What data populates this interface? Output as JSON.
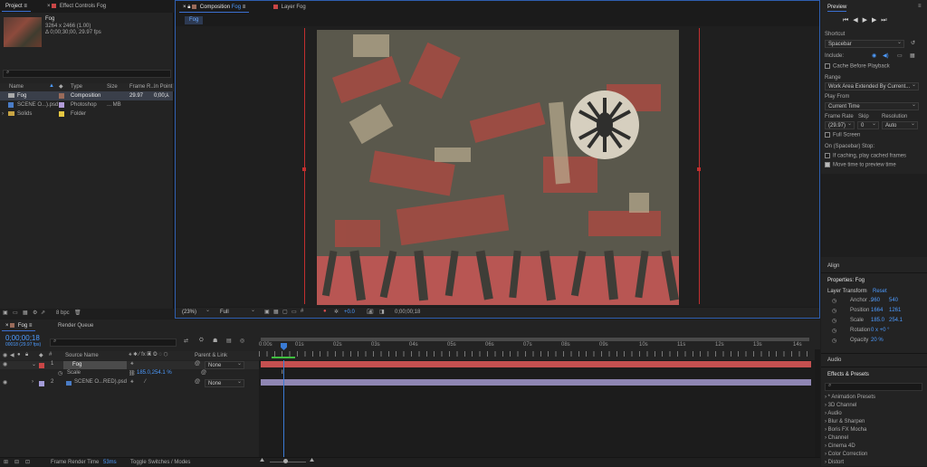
{
  "project": {
    "tab_project": "Project",
    "tab_effect_controls": "Effect Controls",
    "tab_effect_controls_target": "Fog",
    "thumb": {
      "name": "Fog",
      "dims": "3264 x 2466 (1.00)",
      "duration": "Δ 0;00;30;00, 29.97 fps"
    },
    "columns": [
      "Name",
      "Type",
      "Size",
      "Frame R...",
      "In Point"
    ],
    "items": [
      {
        "name": "Fog",
        "type": "Composition",
        "size": "",
        "fps": "29.97",
        "in": "0;00;",
        "color": "#9a6b5a"
      },
      {
        "name": "SCENE O...).psd",
        "type": "Photoshop",
        "size": "... MB",
        "fps": "",
        "in": "",
        "color": "#b29bd8"
      },
      {
        "name": "Solids",
        "type": "Folder",
        "size": "",
        "fps": "",
        "in": "",
        "color": "#e5c742"
      }
    ],
    "bpc": "8 bpc"
  },
  "comp": {
    "tab_composition": "Composition",
    "tab_composition_name": "Fog",
    "tab_layer": "Layer",
    "tab_layer_name": "Fog",
    "breadcrumb": "Fog",
    "zoom": "(23%)",
    "resolution": "Full",
    "exposure": "+0.0",
    "timecode": "0;00;00;18"
  },
  "timeline": {
    "tab_comp": "Fog",
    "tab_render_queue": "Render Queue",
    "timecode": "0;00;00;18",
    "timecode_sub": "00018 (29.97 fps)",
    "col_source_name": "Source Name",
    "col_parent": "Parent & Link",
    "ruler": [
      "0:00s",
      "01s",
      "02s",
      "03s",
      "04s",
      "05s",
      "06s",
      "07s",
      "08s",
      "09s",
      "10s",
      "11s",
      "12s",
      "13s",
      "14s"
    ],
    "layers": [
      {
        "num": "1",
        "name": "Fog",
        "parent": "None",
        "color": "#c94646"
      },
      {
        "num": "2",
        "name": "SCENE O...RED).psd",
        "parent": "None",
        "color": "#a39bd8"
      }
    ],
    "scale_label": "Scale",
    "scale_value": "185.0,254.1 %",
    "footer_render_label": "Frame Render Time",
    "footer_render_value": "53ms",
    "footer_toggle": "Toggle Switches / Modes"
  },
  "preview": {
    "title": "Preview",
    "shortcut_label": "Shortcut",
    "shortcut_value": "Spacebar",
    "include_label": "Include:",
    "cache_before": "Cache Before Playback",
    "range_label": "Range",
    "range_value": "Work Area Extended By Current...",
    "play_from_label": "Play From",
    "play_from_value": "Current Time",
    "frame_rate_label": "Frame Rate",
    "skip_label": "Skip",
    "resolution_label": "Resolution",
    "frame_rate_value": "(29.97)",
    "skip_value": "0",
    "resolution_value": "Auto",
    "full_screen": "Full Screen",
    "on_stop": "On (Spacebar) Stop:",
    "if_caching": "If caching, play cached frames",
    "move_time": "Move time to preview time"
  },
  "align": {
    "title": "Align"
  },
  "properties": {
    "title": "Properties: Fog",
    "layer_transform": "Layer Transform",
    "reset": "Reset",
    "rows": [
      {
        "label": "Anchor ...",
        "v1": "960",
        "v2": "540"
      },
      {
        "label": "Position",
        "v1": "1664",
        "v2": "1261"
      },
      {
        "label": "Scale",
        "v1": "185.0",
        "v2": "254.1"
      },
      {
        "label": "Rotation",
        "v1": "0 x +0 °",
        "v2": ""
      },
      {
        "label": "Opacity",
        "v1": "20 %",
        "v2": ""
      }
    ]
  },
  "audio": {
    "title": "Audio"
  },
  "effects": {
    "title": "Effects & Presets",
    "items": [
      "* Animation Presets",
      "3D Channel",
      "Audio",
      "Blur & Sharpen",
      "Boris FX Mocha",
      "Channel",
      "Cinema 4D",
      "Color Correction",
      "Distort"
    ]
  },
  "colors": {
    "accent": "#4d9bff",
    "layer_bar": "#c55050",
    "layer2_bar": "#8f86b3",
    "work_area": "#3fbf3f",
    "frame_red": "#c22f2f"
  }
}
